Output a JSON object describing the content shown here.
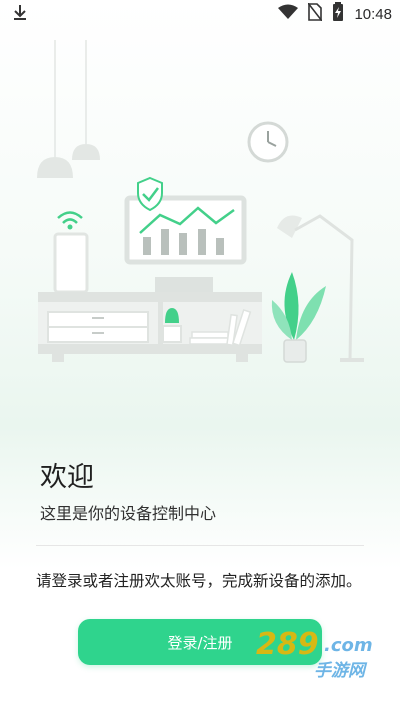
{
  "status_bar": {
    "time": "10:48",
    "icons": [
      "download-icon",
      "wifi-icon",
      "no-sim-icon",
      "battery-charging-icon"
    ]
  },
  "illustration": {
    "icons": [
      "pendant-lamp-icon",
      "wall-clock-icon",
      "shield-check-icon",
      "tv-chart-icon",
      "router-icon",
      "tv-cabinet-icon",
      "cactus-icon",
      "books-icon",
      "plant-icon",
      "floor-lamp-icon"
    ]
  },
  "welcome": {
    "title": "欢迎",
    "subtitle": "这里是你的设备控制中心",
    "instructions": "请登录或者注册欢太账号，完成新设备的添加。"
  },
  "login_button": {
    "label": "登录/注册"
  },
  "watermark": {
    "text": "289.com 手游网"
  },
  "colors": {
    "accent": "#2fd48d",
    "illustration_gray": "#d9dedb",
    "plant_green": "#43d08a"
  }
}
